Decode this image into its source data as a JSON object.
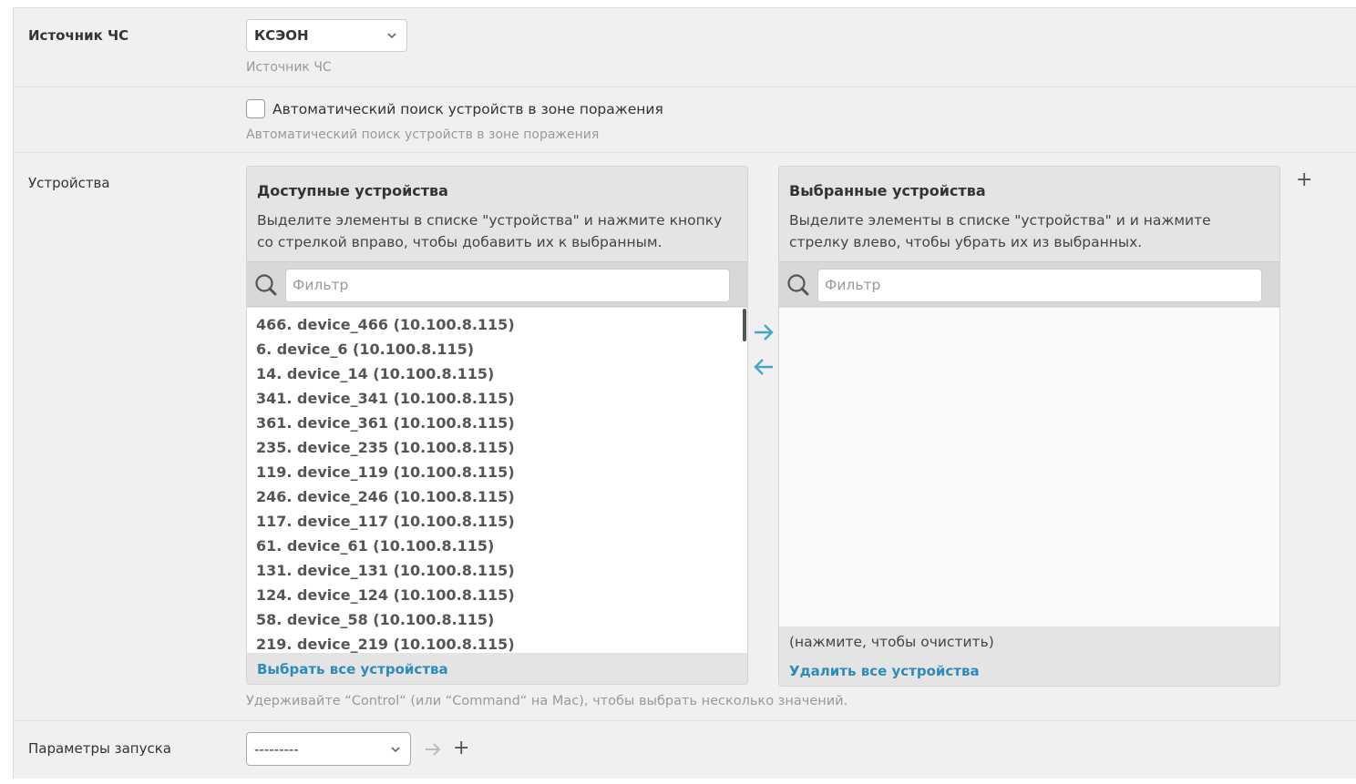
{
  "source": {
    "label": "Источник ЧС",
    "selected": "КСЭОН",
    "help": "Источник ЧС"
  },
  "auto_search": {
    "checkbox_label": "Автоматический поиск устройств в зоне поражения",
    "help": "Автоматический поиск устройств в зоне поражения",
    "checked": false
  },
  "devices": {
    "label": "Устройства",
    "available": {
      "title": "Доступные устройства",
      "description": "Выделите элементы в списке \"устройства\" и нажмите кнопку со стрелкой вправо, чтобы добавить их к выбранным.",
      "filter_placeholder": "Фильтр",
      "items": [
        "466. device_466 (10.100.8.115)",
        "6. device_6 (10.100.8.115)",
        "14. device_14 (10.100.8.115)",
        "341. device_341 (10.100.8.115)",
        "361. device_361 (10.100.8.115)",
        "235. device_235 (10.100.8.115)",
        "119. device_119 (10.100.8.115)",
        "246. device_246 (10.100.8.115)",
        "117. device_117 (10.100.8.115)",
        "61. device_61 (10.100.8.115)",
        "131. device_131 (10.100.8.115)",
        "124. device_124 (10.100.8.115)",
        "58. device_58 (10.100.8.115)",
        "219. device_219 (10.100.8.115)"
      ],
      "choose_all": "Выбрать все устройства"
    },
    "chosen": {
      "title": "Выбранные устройства",
      "description": "Выделите элементы в списке \"устройства\" и и нажмите стрелку влево, чтобы убрать их из выбранных.",
      "filter_placeholder": "Фильтр",
      "items": [],
      "clear_hint": "(нажмите, чтобы очистить)",
      "remove_all": "Удалить все устройства"
    },
    "help": "Удерживайте “Control“ (или “Command“ на Mac), чтобы выбрать несколько значений."
  },
  "launch_params": {
    "label": "Параметры запуска",
    "selected": "---------"
  },
  "colors": {
    "link": "#2e8ab8",
    "arrow": "#4aa3c7",
    "background": "#f0f0f0",
    "panel_header": "#e4e4e4"
  }
}
